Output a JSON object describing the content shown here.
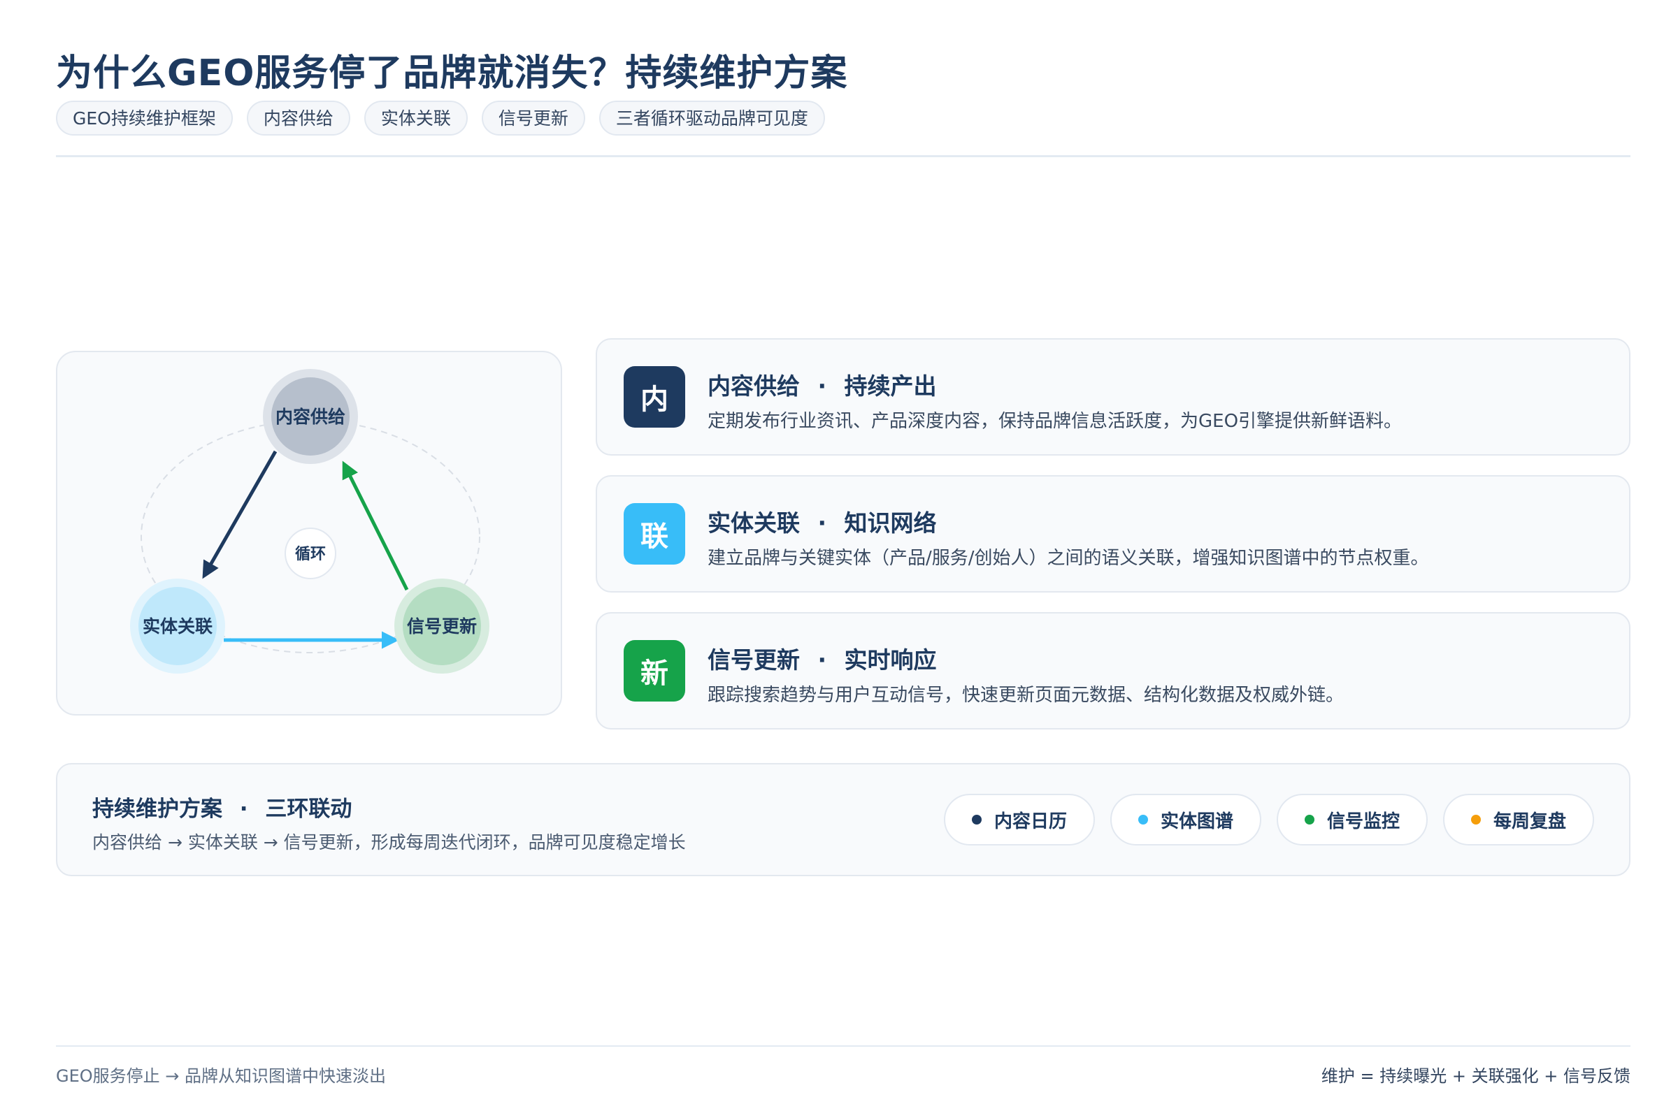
{
  "header": {
    "title": "为什么GEO服务停了品牌就消失？持续维护方案",
    "tags": [
      "GEO持续维护框架",
      "内容供给",
      "实体关联",
      "信号更新",
      "三者循环驱动品牌可见度"
    ]
  },
  "diagram": {
    "nodes": [
      {
        "label": "内容供给",
        "color": "#1e3a5f"
      },
      {
        "label": "实体关联",
        "color": "#38bdf8"
      },
      {
        "label": "信号更新",
        "color": "#16a34a"
      }
    ],
    "center_label": "循环"
  },
  "features": [
    {
      "badge": "内",
      "title": "内容供给",
      "subtitle": "持续产出",
      "separator": "·",
      "color": "#1e3a5f",
      "description": "定期发布行业资讯、产品深度内容，保持品牌信息活跃度，为GEO引擎提供新鲜语料。"
    },
    {
      "badge": "联",
      "title": "实体关联",
      "subtitle": "知识网络",
      "separator": "·",
      "color": "#38bdf8",
      "description": "建立品牌与关键实体（产品/服务/创始人）之间的语义关联，增强知识图谱中的节点权重。"
    },
    {
      "badge": "新",
      "title": "信号更新",
      "subtitle": "实时响应",
      "separator": "·",
      "color": "#16a34a",
      "description": "跟踪搜索趋势与用户互动信号，快速更新页面元数据、结构化数据及权威外链。"
    }
  ],
  "plan": {
    "title": "持续维护方案",
    "subtitle": "三环联动",
    "separator": "·",
    "description": "内容供给 → 实体关联 → 信号更新，形成每周迭代闭环，品牌可见度稳定增长",
    "pills": [
      {
        "label": "内容日历",
        "color": "#1e3a5f"
      },
      {
        "label": "实体图谱",
        "color": "#38bdf8"
      },
      {
        "label": "信号监控",
        "color": "#16a34a"
      },
      {
        "label": "每周复盘",
        "color": "#f59e0b"
      }
    ]
  },
  "footer": {
    "left": "GEO服务停止 → 品牌从知识图谱中快速淡出",
    "right": "维护 = 持续曝光 + 关联强化 + 信号反馈"
  }
}
